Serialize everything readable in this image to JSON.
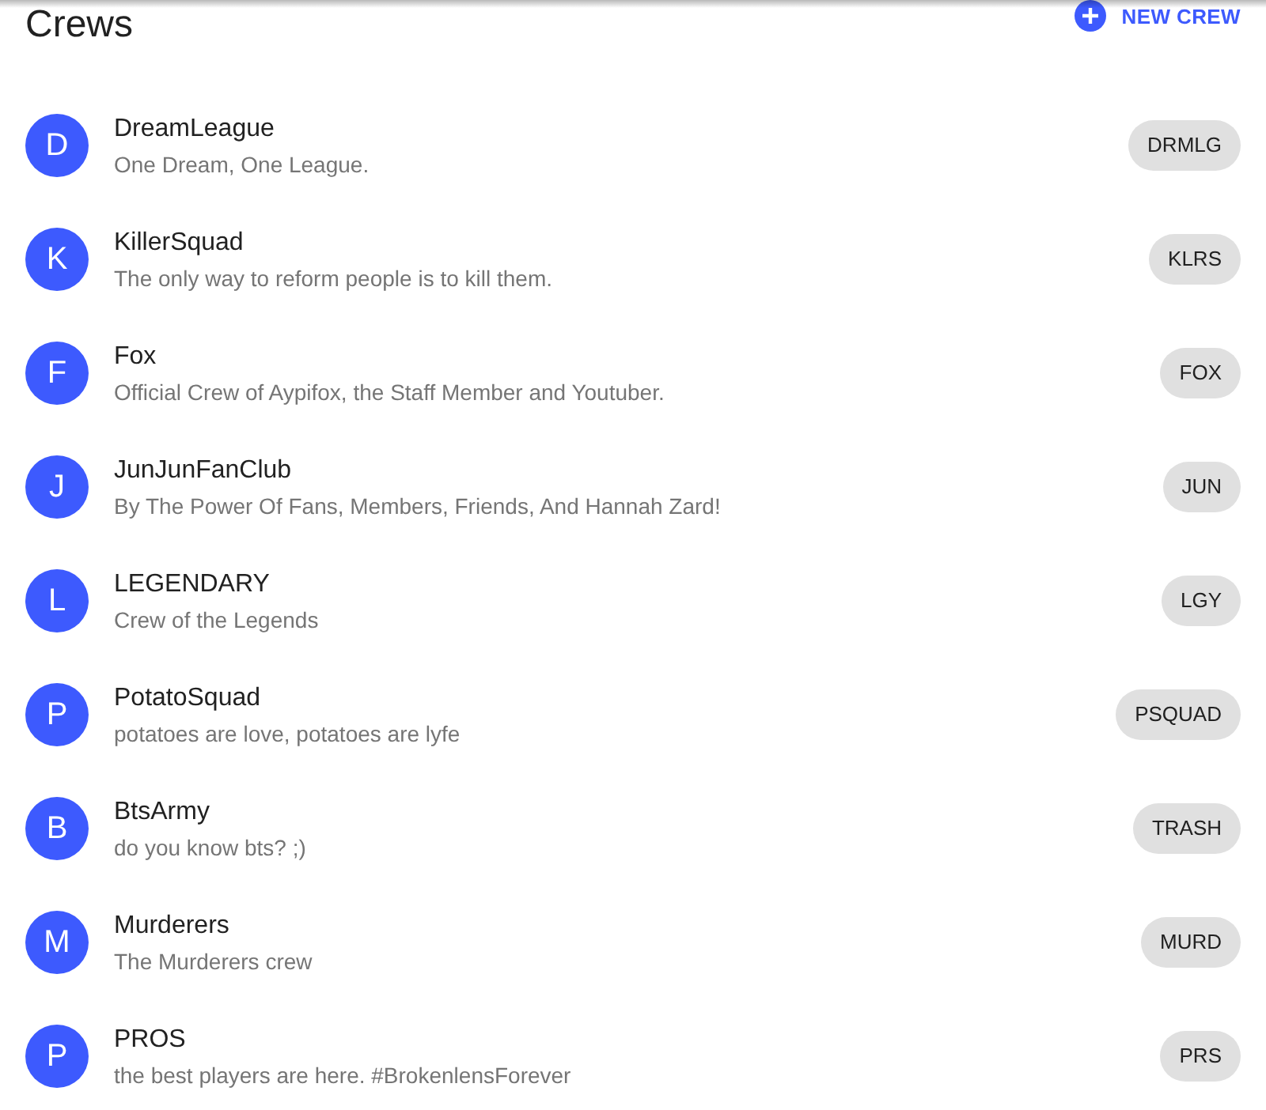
{
  "header": {
    "title": "Crews",
    "new_crew_button": "NEW CREW"
  },
  "crews": [
    {
      "initial": "D",
      "name": "DreamLeague",
      "description": "One Dream, One League.",
      "tag": "DRMLG"
    },
    {
      "initial": "K",
      "name": "KillerSquad",
      "description": "The only way to reform people is to kill them.",
      "tag": "KLRS"
    },
    {
      "initial": "F",
      "name": "Fox",
      "description": "Official Crew of Aypifox, the Staff Member and Youtuber.",
      "tag": "FOX"
    },
    {
      "initial": "J",
      "name": "JunJunFanClub",
      "description": "By The Power Of Fans, Members, Friends, And Hannah Zard!",
      "tag": "JUN"
    },
    {
      "initial": "L",
      "name": "LEGENDARY",
      "description": "Crew of the Legends",
      "tag": "LGY"
    },
    {
      "initial": "P",
      "name": "PotatoSquad",
      "description": "potatoes are love, potatoes are lyfe",
      "tag": "PSQUAD"
    },
    {
      "initial": "B",
      "name": "BtsArmy",
      "description": "do you know bts? ;)",
      "tag": "TRASH"
    },
    {
      "initial": "M",
      "name": "Murderers",
      "description": "The Murderers crew",
      "tag": "MURD"
    },
    {
      "initial": "P",
      "name": "PROS",
      "description": "the best players are here. #BrokenlensForever",
      "tag": "PRS"
    }
  ]
}
